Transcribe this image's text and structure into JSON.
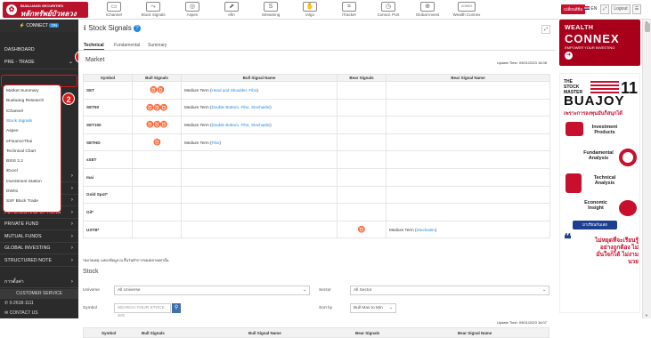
{
  "header": {
    "logo_line1": "BUALUANG SECURITIES",
    "logo_line2": "หลักทรัพย์บัวหลวง",
    "tools": [
      {
        "label": "iChannel",
        "icon": "ichannel-icon",
        "glyph": "▭"
      },
      {
        "label": "Stock Signals",
        "icon": "stock-signals-icon",
        "glyph": "⤳"
      },
      {
        "label": "Aspen",
        "icon": "aspen-icon",
        "glyph": "◎"
      },
      {
        "label": "efin",
        "icon": "efin-icon",
        "glyph": "⬈"
      },
      {
        "label": "Streaming",
        "icon": "streaming-icon",
        "glyph": "S"
      },
      {
        "label": "iAlgo",
        "icon": "ialgo-icon",
        "glyph": "✋"
      },
      {
        "label": "iTracker",
        "icon": "itracker-icon",
        "glyph": "⌗"
      },
      {
        "label": "Consol. Port",
        "icon": "consol-port-icon",
        "glyph": "◷"
      },
      {
        "label": "Global Invest",
        "icon": "global-invest-icon",
        "glyph": "⊕"
      },
      {
        "label": "Wealth Connex",
        "icon": "wealth-connex-icon",
        "glyph": "CONEX"
      }
    ],
    "lang_button": "เปลี่ยนสีธีม",
    "lang": "EN",
    "logout": "Logout"
  },
  "sidebar": {
    "connect_label": "CONNECT",
    "connect_status": "ON",
    "items": [
      {
        "label": "DASHBOARD",
        "chev": ""
      },
      {
        "label": "PRE - TRADE",
        "chev": "⌄"
      },
      {
        "label": "TRADE",
        "chev": "›"
      },
      {
        "label": "POST - TRADE",
        "chev": "›"
      },
      {
        "label": "E - SERVICES",
        "chev": "›"
      },
      {
        "label": "FUTURES AND OPTIONS",
        "chev": "›"
      },
      {
        "label": "PRIVATE FUND",
        "chev": "›"
      },
      {
        "label": "MUTUAL FUNDS",
        "chev": "›"
      },
      {
        "label": "GLOBAL INVESTING",
        "chev": "›"
      },
      {
        "label": "STRUCTURED NOTE",
        "chev": "›"
      },
      {
        "label": "การตั้งค่า",
        "chev": "›"
      }
    ],
    "submenu": [
      "Market Summary",
      "Bualuang Research",
      "iChannel",
      "Stock Signals",
      "Aspen",
      "eFinanceThai",
      "Technical Chart",
      "BSIS 2.2",
      "iExcel",
      "Investment Station",
      "DW01",
      "SSF Block Trade"
    ],
    "customer_service": "CUSTOMER SERVICE",
    "phone": "0-2618-1111",
    "contact": "CONTACT US",
    "callout_1": "1",
    "callout_2": "2"
  },
  "main": {
    "title": "Stock Signals",
    "tabs": [
      "Technical",
      "Fundamental",
      "Summary"
    ],
    "market_heading": "Market",
    "update_time_1": "Update Time: 09/01/2023 16:08",
    "columns": [
      "Symbol",
      "Bull Signals",
      "Bull Signal Name",
      "Bear Signals",
      "Bear Signal Name"
    ],
    "rows": [
      {
        "symbol": "SET",
        "bull": "♉♉",
        "bull_prefix": "Medium Term (",
        "bull_link": "Head and Shoulder, Fibo",
        "bull_suffix": ")",
        "bear": "",
        "bear_prefix": "",
        "bear_link": "",
        "bear_suffix": ""
      },
      {
        "symbol": "SET50",
        "bull": "♉♉♉",
        "bull_prefix": "Medium Term (",
        "bull_link": "Double Bottom, Fibo, Stochastic",
        "bull_suffix": ")",
        "bear": "",
        "bear_prefix": "",
        "bear_link": "",
        "bear_suffix": ""
      },
      {
        "symbol": "SET100",
        "bull": "♉♉♉",
        "bull_prefix": "Medium Term (",
        "bull_link": "Double Bottom, Fibo, Stochastic",
        "bull_suffix": ")",
        "bear": "",
        "bear_prefix": "",
        "bear_link": "",
        "bear_suffix": ""
      },
      {
        "symbol": "SETHD",
        "bull": "♉",
        "bull_prefix": "Medium Term (",
        "bull_link": "Fibo",
        "bull_suffix": ")",
        "bear": "",
        "bear_prefix": "",
        "bear_link": "",
        "bear_suffix": ""
      },
      {
        "symbol": "sSET",
        "bull": "",
        "bull_prefix": "",
        "bull_link": "",
        "bull_suffix": "",
        "bear": "",
        "bear_prefix": "",
        "bear_link": "",
        "bear_suffix": ""
      },
      {
        "symbol": "mai",
        "bull": "",
        "bull_prefix": "",
        "bull_link": "",
        "bull_suffix": "",
        "bear": "",
        "bear_prefix": "",
        "bear_link": "",
        "bear_suffix": ""
      },
      {
        "symbol": "Gold Spot*",
        "bull": "",
        "bull_prefix": "",
        "bull_link": "",
        "bull_suffix": "",
        "bear": "",
        "bear_prefix": "",
        "bear_link": "",
        "bear_suffix": ""
      },
      {
        "symbol": "Oil*",
        "bull": "",
        "bull_prefix": "",
        "bull_link": "",
        "bull_suffix": "",
        "bear": "",
        "bear_prefix": "",
        "bear_link": "",
        "bear_suffix": ""
      },
      {
        "symbol": "USTB*",
        "bull": "",
        "bull_prefix": "",
        "bull_link": "",
        "bull_suffix": "",
        "bear": "♉",
        "bear_prefix": "Medium Term (",
        "bear_link": "Stochastic",
        "bear_suffix": ")"
      }
    ],
    "note": "*หมายเหตุ: แสดงข้อมูล ณ สิ้นวันทำการของตลาดเท่านั้น",
    "stock_heading": "Stock",
    "filters": {
      "universe_label": "Universe",
      "universe_value": "All Universe",
      "sector_label": "Sector",
      "sector_value": "All Sector",
      "symbol_label": "Symbol",
      "symbol_placeholder": "SEARCH YOUR STOCK SIG",
      "sortby_label": "Sort by",
      "sortby_value": "Bull Max to Min"
    },
    "update_time_2": "Update Time: 09/01/2023 16:07",
    "bottom_columns": [
      "Symbol",
      "Bull Signals",
      "Bull Signal Name",
      "Bear Signals",
      "Bear Signal Name"
    ]
  },
  "ad": {
    "wealth_line1": "WEALTH",
    "wealth_line2": "CONNEX",
    "wealth_tag": "EMPOWER YOUR INVESTING",
    "stock_master_line1": "THE",
    "stock_master_line2": "STOCK",
    "stock_master_line3": "MASTER",
    "eleven": "11",
    "buajoy": "BUAJOY",
    "thai_headline": "เพราะการลงทุนมันก็สนุกได้",
    "products": [
      "Investment Products",
      "Fundamental Analysis",
      "Technical Analysis",
      "Economic Insight"
    ],
    "cta": "มาเรียนกันเลย",
    "thai_quote": "ไม่หยุดที่จะเรียนรู้ อย่างถูกต้อง ไม่มั่นใจก็ได้ ไม่งามนวย"
  }
}
